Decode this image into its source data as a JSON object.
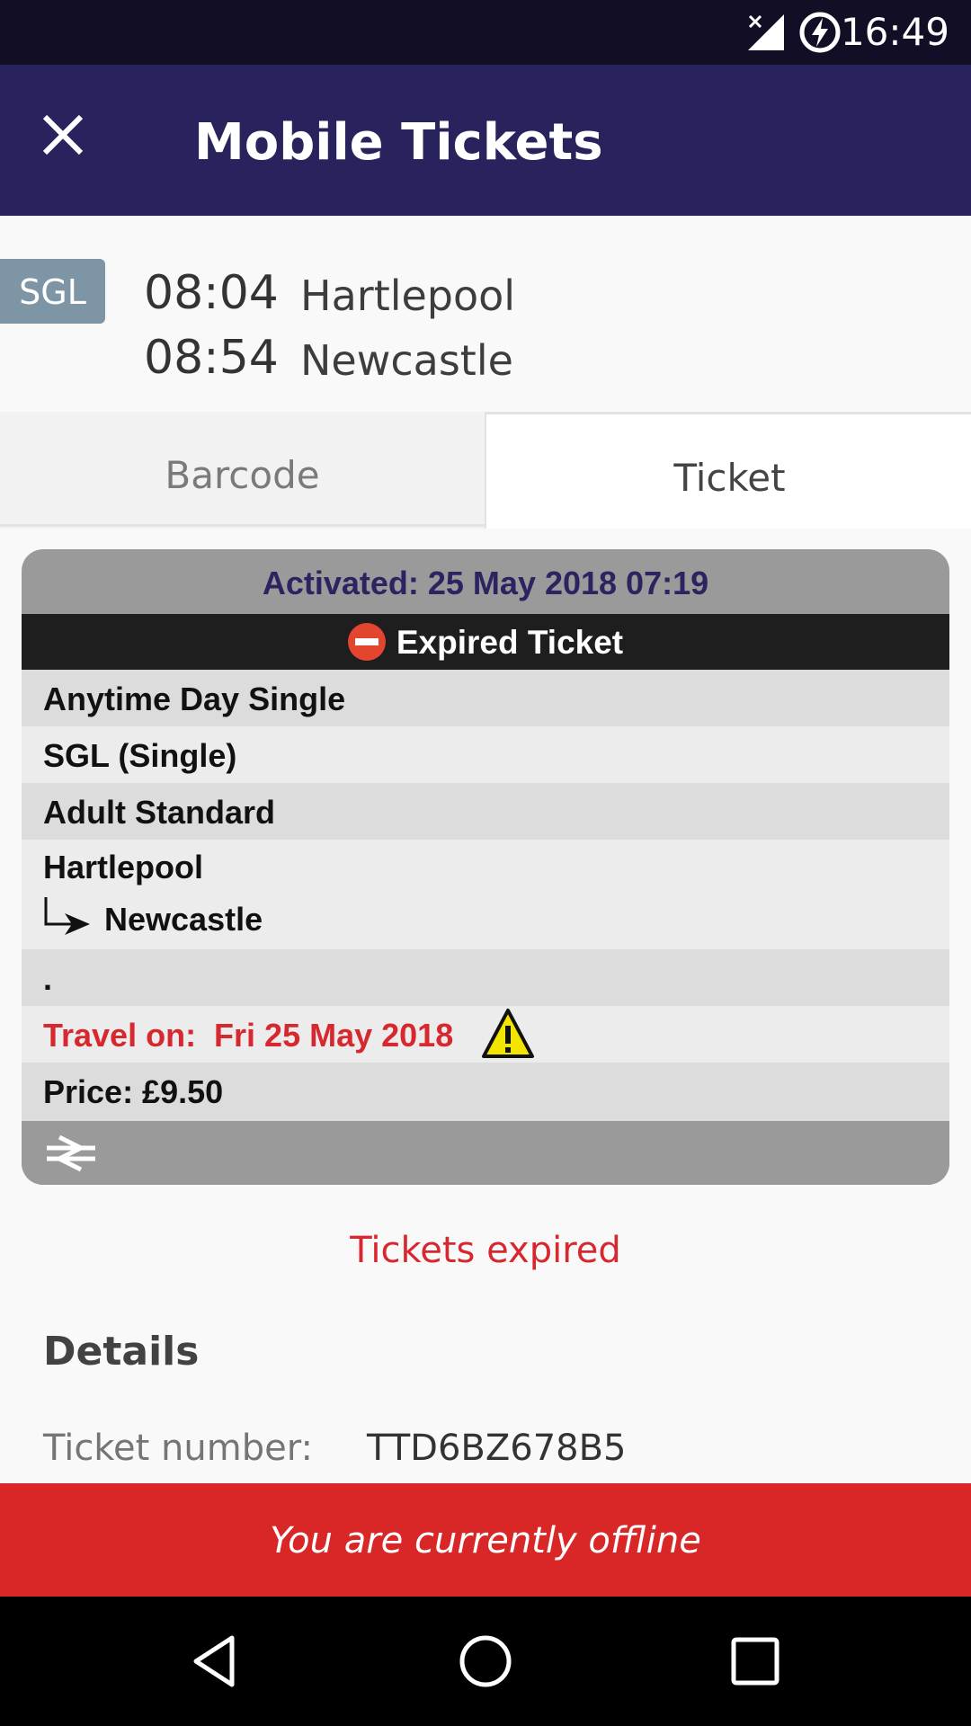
{
  "status_bar": {
    "time": "16:49",
    "signal_icon": "signal-off-icon",
    "battery_icon": "battery-charging-icon"
  },
  "app_bar": {
    "title": "Mobile Tickets",
    "close_icon": "close-icon"
  },
  "journey": {
    "badge": "SGL",
    "departure_time": "08:04",
    "departure_station": "Hartlepool",
    "arrival_time": "08:54",
    "arrival_station": "Newcastle"
  },
  "tabs": [
    {
      "label": "Barcode",
      "selected": false
    },
    {
      "label": "Ticket",
      "selected": true
    }
  ],
  "ticket": {
    "activated": "Activated: 25 May 2018 07:19",
    "status": "Expired Ticket",
    "ticket_type": "Anytime Day Single",
    "fare": "SGL (Single)",
    "passenger": "Adult Standard",
    "origin": "Hartlepool",
    "destination": "Newcastle",
    "route_note": ".",
    "travel_on": "Travel on:  Fri 25 May 2018",
    "price": "Price: £9.50",
    "colors": {
      "activated_text": "#2b2460",
      "travel_text": "#d7282f",
      "status_bg": "#1e1e1e"
    }
  },
  "expired_message": "Tickets expired",
  "details": {
    "title": "Details",
    "ticket_number_label": "Ticket number:",
    "ticket_number_value": "TTD6BZ678B5"
  },
  "offline_banner": "You are currently offline",
  "colors": {
    "app_bar": "#28235c",
    "offline": "#d92626"
  }
}
